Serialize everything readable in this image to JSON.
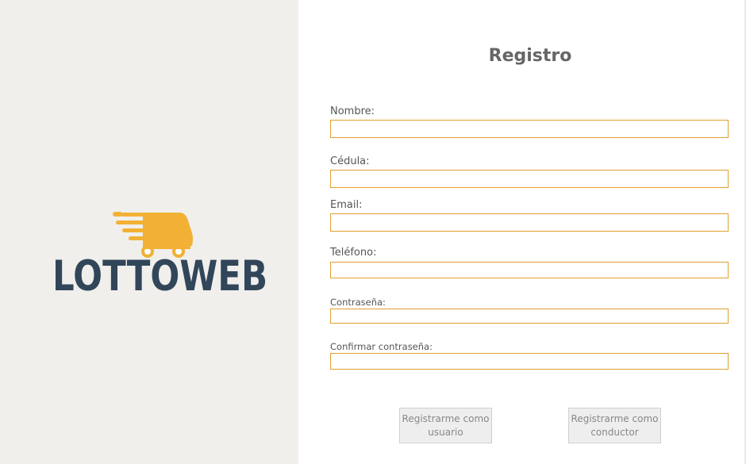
{
  "logo": {
    "text": "LOTTOWEB",
    "icon": "delivery-truck-icon",
    "icon_color": "#f2b134",
    "text_color": "#32465a"
  },
  "form": {
    "title": "Registro",
    "fields": [
      {
        "label": "Nombre:",
        "value": "",
        "placeholder": ""
      },
      {
        "label": "Cédula:",
        "value": "",
        "placeholder": ""
      },
      {
        "label": "Email:",
        "value": "",
        "placeholder": ""
      },
      {
        "label": "Teléfono:",
        "value": "",
        "placeholder": ""
      },
      {
        "label": "Contraseña:",
        "value": "",
        "placeholder": ""
      },
      {
        "label": "Confirmar contraseña:",
        "value": "",
        "placeholder": ""
      }
    ],
    "buttons": {
      "user_label": "Registrarme como usuario",
      "driver_label": "Registrarme como conductor"
    }
  },
  "colors": {
    "input_border": "#e0a030",
    "left_background": "#f0efec"
  }
}
